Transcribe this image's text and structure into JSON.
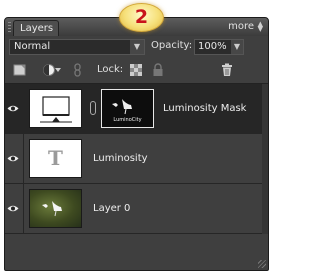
{
  "badge": {
    "number": "2",
    "color": "#c8131b"
  },
  "panel": {
    "tab_label": "Layers",
    "more_label": "more",
    "blend_mode": "Normal",
    "opacity_label": "Opacity:",
    "opacity_value": "100%",
    "lock_label": "Lock:"
  },
  "layers": [
    {
      "name": "Luminosity Mask",
      "selected": true,
      "thumb_text": "LuminoCity"
    },
    {
      "name": "Luminosity",
      "selected": false,
      "thumb_text": "T"
    },
    {
      "name": "Layer 0",
      "selected": false
    }
  ],
  "icons": {
    "new_layer": "new-layer-icon",
    "adjustment": "adjustment-layer-icon",
    "link": "link-icon",
    "lock_transparency": "lock-transparency-icon",
    "lock_all": "lock-all-icon",
    "delete": "trash-icon",
    "visibility": "eye-icon"
  }
}
